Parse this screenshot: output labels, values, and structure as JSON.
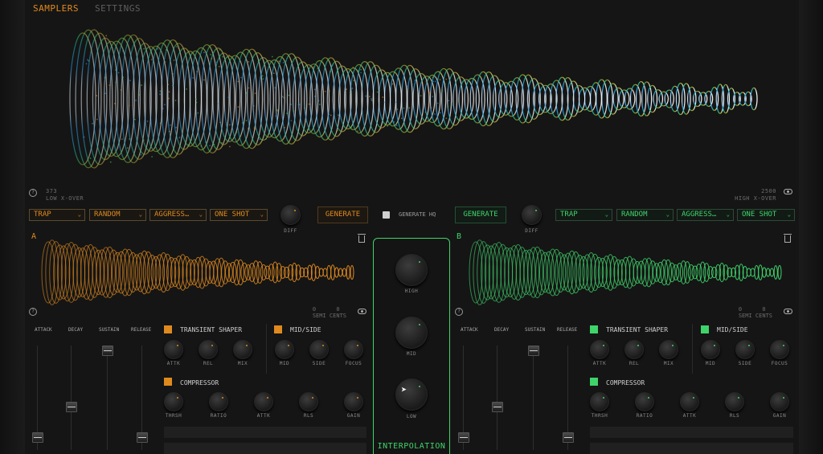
{
  "tabs": [
    "SAMPLERS",
    "SETTINGS"
  ],
  "xover": {
    "low_value": "373",
    "low_label": "LOW X-OVER",
    "high_value": "2500",
    "high_label": "HIGH X-OVER"
  },
  "controls_a": [
    "TRAP",
    "RANDOM",
    "AGGRESS…",
    "ONE SHOT"
  ],
  "controls_b": [
    "TRAP",
    "RANDOM",
    "AGGRESS…",
    "ONE SHOT"
  ],
  "diff_label": "DIFF",
  "generate_label": "GENERATE",
  "generate_hq_label": "GENERATE HQ",
  "sampler_a": {
    "label": "A",
    "semi": "0",
    "cents": "0"
  },
  "sampler_b": {
    "label": "B",
    "semi": "0",
    "cents": "0"
  },
  "semi_label": "SEMI",
  "cents_label": "CENTS",
  "adsr": [
    "ATTACK",
    "DECAY",
    "SUSTAIN",
    "RELEASE"
  ],
  "transient": {
    "title": "TRANSIENT SHAPER",
    "knobs": [
      "ATTK",
      "REL",
      "MIX"
    ]
  },
  "midside": {
    "title": "MID/SIDE",
    "knobs": [
      "MID",
      "SIDE",
      "FOCUS"
    ]
  },
  "compressor": {
    "title": "COMPRESSOR",
    "knobs": [
      "THRSH",
      "RATIO",
      "ATTK",
      "RLS",
      "GAIN"
    ]
  },
  "interpolation": {
    "title": "INTERPOLATION",
    "knobs": [
      "HIGH",
      "MID",
      "LOW"
    ]
  },
  "colors": {
    "accent_a": "#e08a1e",
    "accent_b": "#3fd46a"
  }
}
